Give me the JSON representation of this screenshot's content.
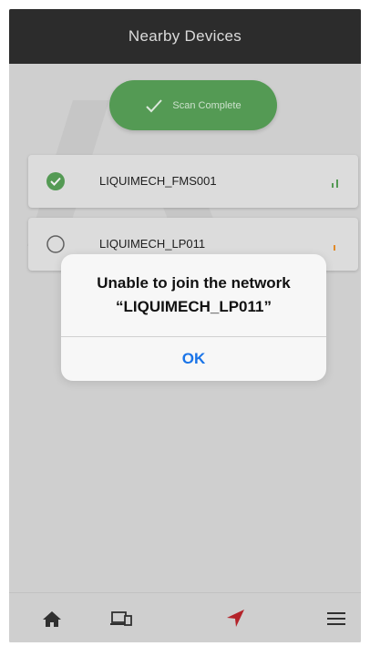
{
  "header": {
    "title": "Nearby Devices"
  },
  "scan": {
    "label": "Scan Complete",
    "icon": "checkmark-icon"
  },
  "devices": [
    {
      "name": "LIQUIMECH_FMS001",
      "selected": true,
      "signal_color": "#5aa45a"
    },
    {
      "name": "LIQUIMECH_LP011",
      "selected": false,
      "signal_color": "#f0932b"
    }
  ],
  "alert": {
    "line1": "Unable to join the network",
    "line2": "“LIQUIMECH_LP011”",
    "ok_label": "OK"
  },
  "tabs": [
    {
      "name": "home-icon"
    },
    {
      "name": "devices-icon"
    },
    {
      "name": "navigation-arrow-icon",
      "active": true
    },
    {
      "name": "menu-icon"
    }
  ],
  "colors": {
    "header_bg": "#2f2f2f",
    "accent_green": "#5aa45a",
    "alert_button": "#1a74e8",
    "active_tab": "#c0262d"
  }
}
